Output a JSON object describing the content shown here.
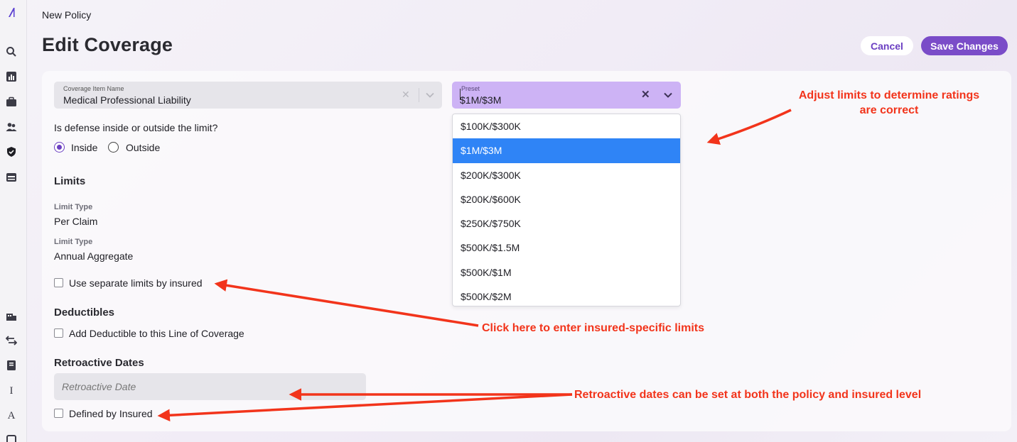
{
  "app": {
    "logo_glyph": "/\\",
    "sidebar_icons": [
      "search-icon",
      "chart-icon",
      "briefcase-icon",
      "users-icon",
      "shield-icon",
      "archive-icon",
      "building-icon",
      "transfer-icon",
      "book-icon",
      "italic-i-icon",
      "font-a-icon",
      "document-icon"
    ]
  },
  "header": {
    "breadcrumb": "New Policy",
    "title": "Edit Coverage",
    "cancel_label": "Cancel",
    "save_label": "Save Changes"
  },
  "coverage_item": {
    "label": "Coverage Item Name",
    "value": "Medical Professional Liability"
  },
  "preset": {
    "label": "Preset",
    "value": "$1M/$3M",
    "options": [
      "$100K/$300K",
      "$1M/$3M",
      "$200K/$300K",
      "$200K/$600K",
      "$250K/$750K",
      "$500K/$1.5M",
      "$500K/$1M",
      "$500K/$2M"
    ],
    "selected_index": 1
  },
  "defense": {
    "question": "Is defense inside or outside the limit?",
    "options": [
      "Inside",
      "Outside"
    ],
    "selected": "Inside"
  },
  "limits": {
    "heading": "Limits",
    "items": [
      {
        "label": "Limit Type",
        "value": "Per Claim"
      },
      {
        "label": "Limit Type",
        "value": "Annual Aggregate"
      }
    ],
    "separate_checkbox_label": "Use separate limits by insured"
  },
  "deductibles": {
    "heading": "Deductibles",
    "checkbox_label": "Add Deductible to this Line of Coverage"
  },
  "retroactive": {
    "heading": "Retroactive Dates",
    "placeholder": "Retroactive Date",
    "checkbox_label": "Defined by Insured"
  },
  "annotations": {
    "limits_note_line1": "Adjust limits to determine ratings",
    "limits_note_line2": "are correct",
    "insured_note": "Click here to enter insured-specific limits",
    "retro_note": "Retroactive dates can be set at both the policy and insured level",
    "color": "#f2341b"
  },
  "colors": {
    "accent": "#7a4cc8",
    "preset_bg": "#cdb3f5",
    "selected_option": "#2f84f6"
  }
}
